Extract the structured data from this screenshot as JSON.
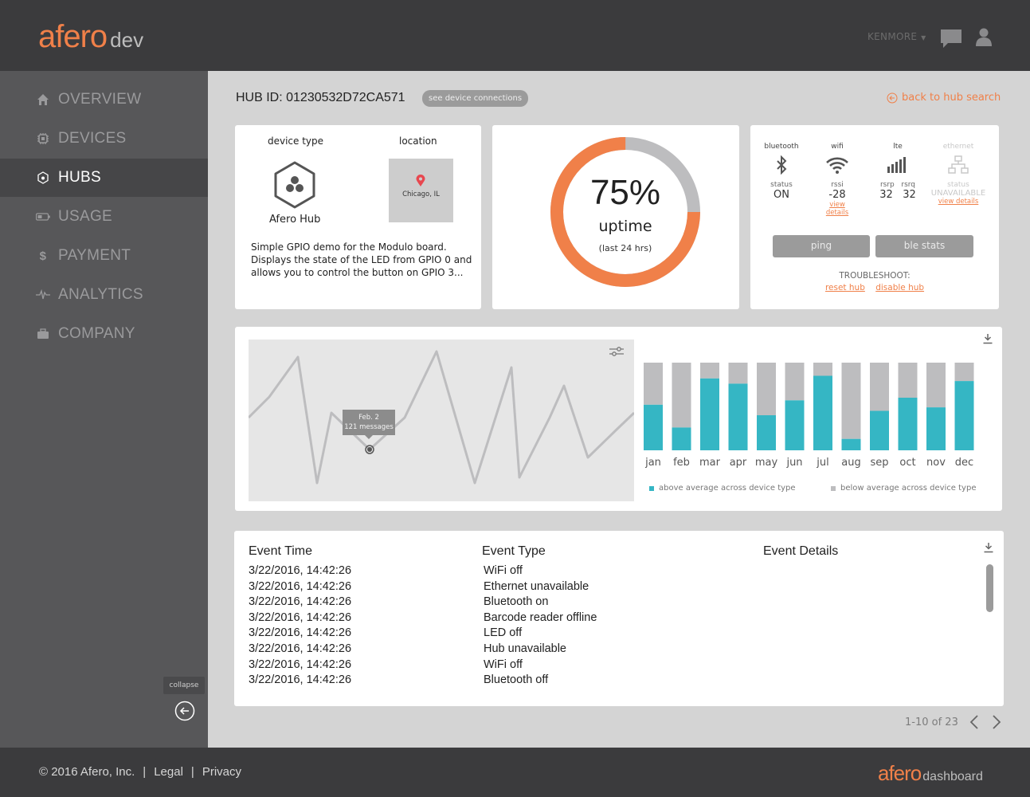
{
  "header": {
    "logo_brand": "afero",
    "logo_suffix": "dev",
    "account": "KENMORE"
  },
  "sidebar": {
    "items": [
      {
        "label": "OVERVIEW",
        "icon": "home-icon"
      },
      {
        "label": "DEVICES",
        "icon": "chip-icon"
      },
      {
        "label": "HUBS",
        "icon": "hub-icon"
      },
      {
        "label": "USAGE",
        "icon": "battery-icon"
      },
      {
        "label": "PAYMENT",
        "icon": "dollar-icon"
      },
      {
        "label": "ANALYTICS",
        "icon": "pulse-icon"
      },
      {
        "label": "COMPANY",
        "icon": "briefcase-icon"
      }
    ],
    "active": "HUBS",
    "collapse_label": "collapse"
  },
  "page": {
    "hub_id": "HUB ID: 01230532D72CA571",
    "device_connections_btn": "see device connections",
    "back_link": "back to hub search"
  },
  "device_card": {
    "device_type_label": "device type",
    "location_label": "location",
    "device_name": "Afero Hub",
    "location": "Chicago, IL",
    "description": "Simple GPIO demo for the Modulo board. Displays the state of the LED from GPIO 0 and allows you to control the button on GPIO 3..."
  },
  "uptime": {
    "value": "75%",
    "label": "uptime",
    "sub": "(last 24 hrs)",
    "fraction": 0.75,
    "color": "#f08049"
  },
  "connectivity": {
    "bluetooth": {
      "head": "bluetooth",
      "sub": "status",
      "value": "ON"
    },
    "wifi": {
      "head": "wifi",
      "sub": "rssi",
      "value": "-28",
      "link": "view details"
    },
    "lte": {
      "head": "lte",
      "sub1": "rsrp",
      "sub2": "rsrq",
      "val1": "32",
      "val2": "32"
    },
    "ethernet": {
      "head": "ethernet",
      "sub": "status",
      "value": "UNAVAILABLE",
      "link": "view details"
    },
    "ping_btn": "ping",
    "ble_btn": "ble stats",
    "troubleshoot": "TROUBLESHOOT:",
    "reset_link": "reset hub",
    "disable_link": "disable hub"
  },
  "line_chart": {
    "tooltip_date": "Feb. 2",
    "tooltip_value": "121 messages"
  },
  "chart_data": {
    "type": "bar",
    "stacked": true,
    "categories": [
      "jan",
      "feb",
      "mar",
      "apr",
      "may",
      "jun",
      "jul",
      "aug",
      "sep",
      "oct",
      "nov",
      "dec"
    ],
    "series": [
      {
        "name": "above average across device type",
        "color": "#35b6c4",
        "values": [
          0.52,
          0.26,
          0.82,
          0.76,
          0.4,
          0.57,
          0.85,
          0.13,
          0.45,
          0.6,
          0.49,
          0.79
        ]
      },
      {
        "name": "below average across device type",
        "color": "#bdbdbf",
        "values": [
          0.48,
          0.74,
          0.18,
          0.24,
          0.6,
          0.43,
          0.15,
          0.87,
          0.55,
          0.4,
          0.51,
          0.21
        ]
      }
    ],
    "ylim": [
      0,
      1
    ]
  },
  "events": {
    "headers": [
      "Event Time",
      "Event Type",
      "Event Details"
    ],
    "rows": [
      {
        "time": "3/22/2016, 14:42:26",
        "type": "WiFi off"
      },
      {
        "time": "3/22/2016, 14:42:26",
        "type": "Ethernet unavailable"
      },
      {
        "time": "3/22/2016, 14:42:26",
        "type": "Bluetooth on"
      },
      {
        "time": "3/22/2016, 14:42:26",
        "type": "Barcode reader offline"
      },
      {
        "time": "3/22/2016, 14:42:26",
        "type": "LED off"
      },
      {
        "time": "3/22/2016, 14:42:26",
        "type": "Hub unavailable"
      },
      {
        "time": "3/22/2016, 14:42:26",
        "type": "WiFi off"
      },
      {
        "time": "3/22/2016, 14:42:26",
        "type": "Bluetooth off"
      }
    ],
    "pager": "1-10 of 23"
  },
  "footer": {
    "copyright": "© 2016 Afero, Inc.",
    "legal": "Legal",
    "privacy": "Privacy",
    "logo_brand": "afero",
    "logo_suffix": "dashboard"
  },
  "colors": {
    "accent": "#f08049",
    "teal": "#35b6c4",
    "header_bg": "#3b3b3d",
    "sidebar_bg": "#575759"
  }
}
